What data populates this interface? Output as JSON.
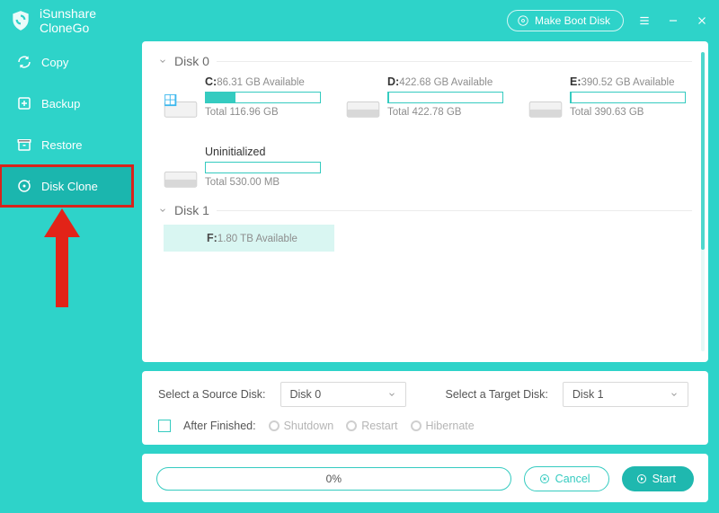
{
  "brand": {
    "line1": "iSunshare",
    "line2": "CloneGo"
  },
  "titlebar": {
    "make_boot": "Make Boot Disk"
  },
  "sidebar": {
    "items": [
      {
        "label": "Copy",
        "icon": "refresh-icon"
      },
      {
        "label": "Backup",
        "icon": "plus-box-icon"
      },
      {
        "label": "Restore",
        "icon": "archive-icon"
      },
      {
        "label": "Disk Clone",
        "icon": "disk-clone-icon"
      }
    ],
    "active_index": 3
  },
  "disks": [
    {
      "name": "Disk 0",
      "partitions": [
        {
          "letter": "C:",
          "avail": "86.31 GB Available",
          "total": "Total 116.96 GB",
          "fill_pct": 26,
          "os": true
        },
        {
          "letter": "D:",
          "avail": "422.68 GB Available",
          "total": "Total 422.78 GB",
          "fill_pct": 1,
          "os": false
        },
        {
          "letter": "E:",
          "avail": "390.52 GB Available",
          "total": "Total 390.63 GB",
          "fill_pct": 1,
          "os": false
        },
        {
          "letter": "",
          "avail": "Uninitialized",
          "total": "Total 530.00 MB",
          "fill_pct": 0,
          "os": false
        }
      ]
    },
    {
      "name": "Disk 1",
      "partitions": [
        {
          "letter": "F:",
          "avail": "1.80 TB Available",
          "total": "",
          "fill_pct": 0,
          "os": false,
          "highlight": true
        }
      ]
    }
  ],
  "select": {
    "source_label": "Select a Source Disk:",
    "source_value": "Disk 0",
    "target_label": "Select a Target Disk:",
    "target_value": "Disk 1",
    "after_label": "After Finished:",
    "options": [
      "Shutdown",
      "Restart",
      "Hibernate"
    ]
  },
  "footer": {
    "progress_text": "0%",
    "cancel": "Cancel",
    "start": "Start"
  }
}
